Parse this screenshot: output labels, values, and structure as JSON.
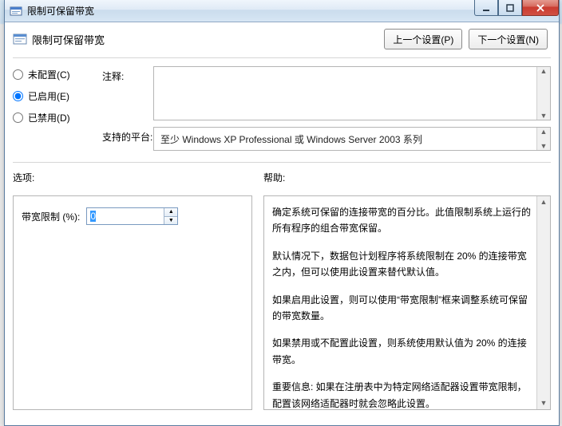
{
  "window": {
    "title": "限制可保留带宽"
  },
  "header": {
    "title": "限制可保留带宽",
    "prev_setting": "上一个设置(P)",
    "next_setting": "下一个设置(N)"
  },
  "radios": {
    "not_configured": "未配置(C)",
    "enabled": "已启用(E)",
    "disabled": "已禁用(D)",
    "selected": "enabled"
  },
  "fields": {
    "comment_label": "注释:",
    "comment_value": "",
    "platform_label": "支持的平台:",
    "platform_value": "至少 Windows XP Professional 或 Windows Server 2003 系列"
  },
  "options": {
    "label": "选项:",
    "bandwidth_label": "带宽限制 (%):",
    "bandwidth_value": "0"
  },
  "help": {
    "label": "帮助:",
    "p1": "确定系统可保留的连接带宽的百分比。此值限制系统上运行的所有程序的组合带宽保留。",
    "p2": "默认情况下，数据包计划程序将系统限制在 20% 的连接带宽之内，但可以使用此设置来替代默认值。",
    "p3": "如果启用此设置，则可以使用“带宽限制”框来调整系统可保留的带宽数量。",
    "p4": "如果禁用或不配置此设置，则系统使用默认值为 20% 的连接带宽。",
    "p5": "重要信息: 如果在注册表中为特定网络适配器设置带宽限制，配置该网络适配器时就会忽略此设置。"
  }
}
